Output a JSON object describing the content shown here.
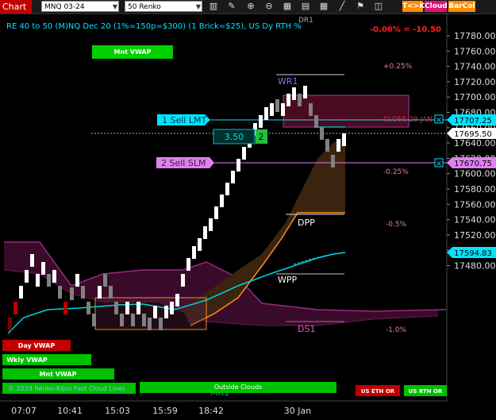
{
  "toolbar": {
    "chart_tab": "Chart",
    "instrument": "MNQ 03-24",
    "bar_type": "50 Renko",
    "buttons": {
      "tk": "T<>K",
      "cloud": "Cloud",
      "barcol": "BarCol"
    },
    "icons": [
      "bar-style-icon",
      "draw-pencil-icon",
      "zoom-in-icon",
      "zoom-out-icon",
      "properties-icon",
      "data-box-icon",
      "grid-icon",
      "line-draw-icon",
      "trade-icon",
      "more-tools-icon"
    ]
  },
  "chart": {
    "title": "RE 40 to 50 (M)NQ Dec 20 (1%=150p=$300) (1 Brick=$25), US Dy RTH %",
    "change": "-0.06% = -10.50",
    "price_labels": [
      "17780.00",
      "17760.00",
      "17740.00",
      "17720.00",
      "17700.00",
      "17680.00",
      "17660.00",
      "17640.00",
      "17620.00",
      "17600.00",
      "17580.00",
      "17560.00",
      "17540.00",
      "17520.00",
      "17500.00",
      "17480.00"
    ],
    "time_labels": [
      "07:07",
      "10:41",
      "15:03",
      "15:59",
      "18:42",
      "30 Jan"
    ],
    "markers": {
      "current_price": "17695.50",
      "sell_lmt_price": "17707.25",
      "sell_slm_price": "17670.75",
      "vwap_price": "17594.83"
    },
    "orders": {
      "sell_lmt": "1 Sell LMT",
      "sell_slm": "2 Sell SLM",
      "pnl_value": "3.50",
      "qty": "2"
    },
    "levels": {
      "dr1": "DR1",
      "wr1": "WR1",
      "dpp": "DPP",
      "wpp": "WPP",
      "ds1": "DS1",
      "mr1": "MR1",
      "close_label": "CLOSE 29 JAN",
      "pct_plus": "+0.25%",
      "pct_m025": "-0.25%",
      "pct_m05": "-0.5%",
      "pct_m1": "-1.0%"
    },
    "badges": {
      "mnt_vwap_top": "Mnt VWAP",
      "day_vwap": "Day VWAP",
      "wkly_vwap": "Wkly VWAP",
      "mnt_vwap": "Mnt VWAP",
      "outside_clouds": "Outside Clouds",
      "us_eth_or": "US ETH OR",
      "us_rth_or": "US RTH OR",
      "footer_text": "© 2024 Renko-Kijun Fast Cloud Lines"
    },
    "colors": {
      "up_brick": "#ffffff",
      "down_brick": "#808080",
      "accent_cyan": "#00e5ff",
      "vwap_green": "#00c000",
      "sell_slm": "#e080f0",
      "dpp_orange": "#ff8c20",
      "cloud_purple": "#7a1a5a"
    }
  }
}
